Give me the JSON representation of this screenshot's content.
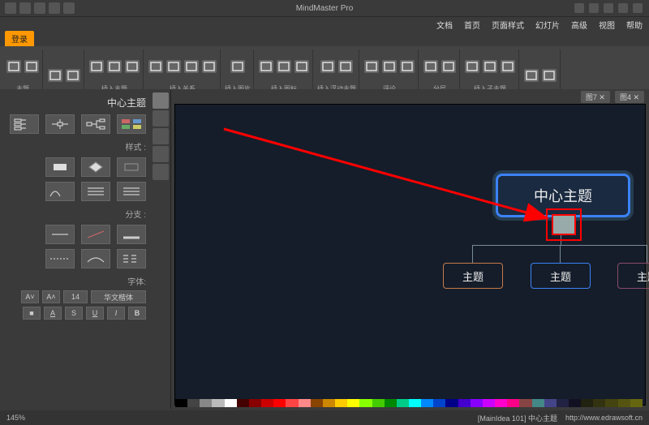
{
  "app": {
    "title": "MindMaster Pro"
  },
  "menus": [
    "文档",
    "首页",
    "页面样式",
    "幻灯片",
    "高级",
    "视图",
    "帮助"
  ],
  "tabs": {
    "active": "登录"
  },
  "ribbon_groups": [
    {
      "label": "主题",
      "count": 2
    },
    {
      "label": "",
      "count": 2
    },
    {
      "label": "插入主题",
      "count": 3
    },
    {
      "label": "插入关系",
      "count": 4
    },
    {
      "label": "插入图片",
      "count": 1
    },
    {
      "label": "插入图标",
      "count": 3
    },
    {
      "label": "插入浮动主题",
      "count": 2
    },
    {
      "label": "评论",
      "count": 3
    },
    {
      "label": "分层",
      "count": 2
    },
    {
      "label": "插入子主题",
      "count": 3
    },
    {
      "label": "",
      "count": 2
    }
  ],
  "doc_tabs": [
    "图7 ✕",
    "图4 ✕"
  ],
  "side": {
    "title": "中心主题",
    "label1": "样式 :",
    "label2": "分支 :",
    "label3": "字体:",
    "font_name": "华文楷体",
    "font_size": "14"
  },
  "mindmap": {
    "root": "中心主题",
    "sub1": "主题",
    "sub2": "主题",
    "sub3": "主题"
  },
  "status": {
    "url": "http://www.edrawsoft.cn",
    "info": "[MainIdea 101] 中心主题",
    "zoom": "145%"
  },
  "palette": [
    "#000",
    "#444",
    "#888",
    "#bbb",
    "#fff",
    "#400",
    "#800",
    "#c00",
    "#f00",
    "#f44",
    "#f88",
    "#840",
    "#c80",
    "#fc0",
    "#ff0",
    "#8f0",
    "#4c0",
    "#080",
    "#0c8",
    "#0ff",
    "#08f",
    "#04c",
    "#008",
    "#40c",
    "#80f",
    "#c0f",
    "#f0c",
    "#f08",
    "#844",
    "#488",
    "#448",
    "#224",
    "#112",
    "#221",
    "#331",
    "#441",
    "#551",
    "#661"
  ]
}
